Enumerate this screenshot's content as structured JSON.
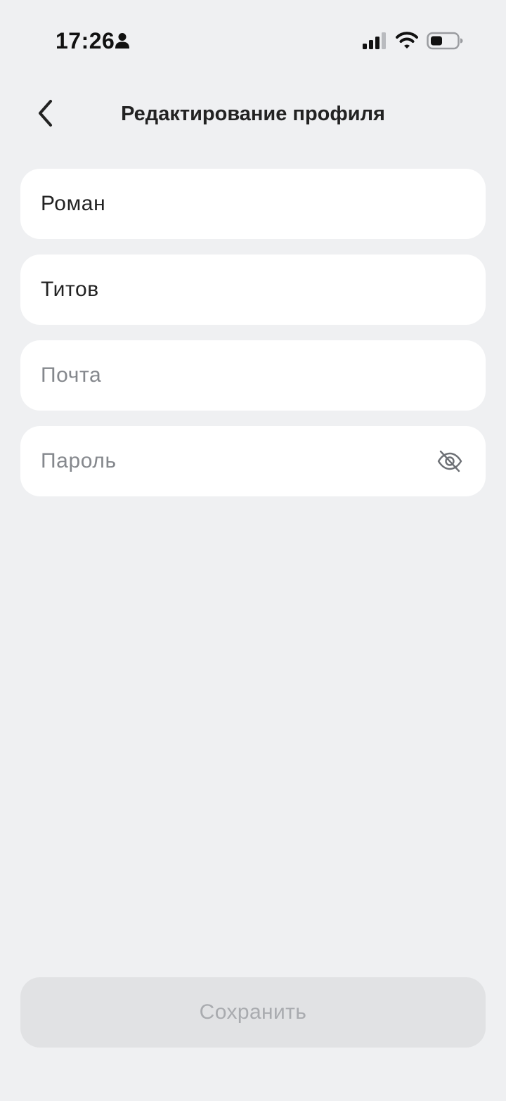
{
  "status_bar": {
    "time": "17:26",
    "icons": [
      "person-icon",
      "cellular-signal-icon",
      "wifi-icon",
      "battery-icon"
    ]
  },
  "header": {
    "title": "Редактирование профиля",
    "back_icon": "chevron-left-icon"
  },
  "form": {
    "first_name": {
      "value": "Роман",
      "placeholder": ""
    },
    "last_name": {
      "value": "Титов",
      "placeholder": ""
    },
    "email": {
      "value": "",
      "placeholder": "Почта"
    },
    "password": {
      "value": "",
      "placeholder": "Пароль",
      "toggle_icon": "eye-slash-icon"
    }
  },
  "actions": {
    "save_label": "Сохранить",
    "save_enabled": false
  },
  "colors": {
    "background": "#eff0f2",
    "field_background": "#ffffff",
    "text": "#222222",
    "placeholder": "#85888d",
    "button_disabled_bg": "#e1e2e4",
    "button_disabled_text": "#a9abaf"
  }
}
